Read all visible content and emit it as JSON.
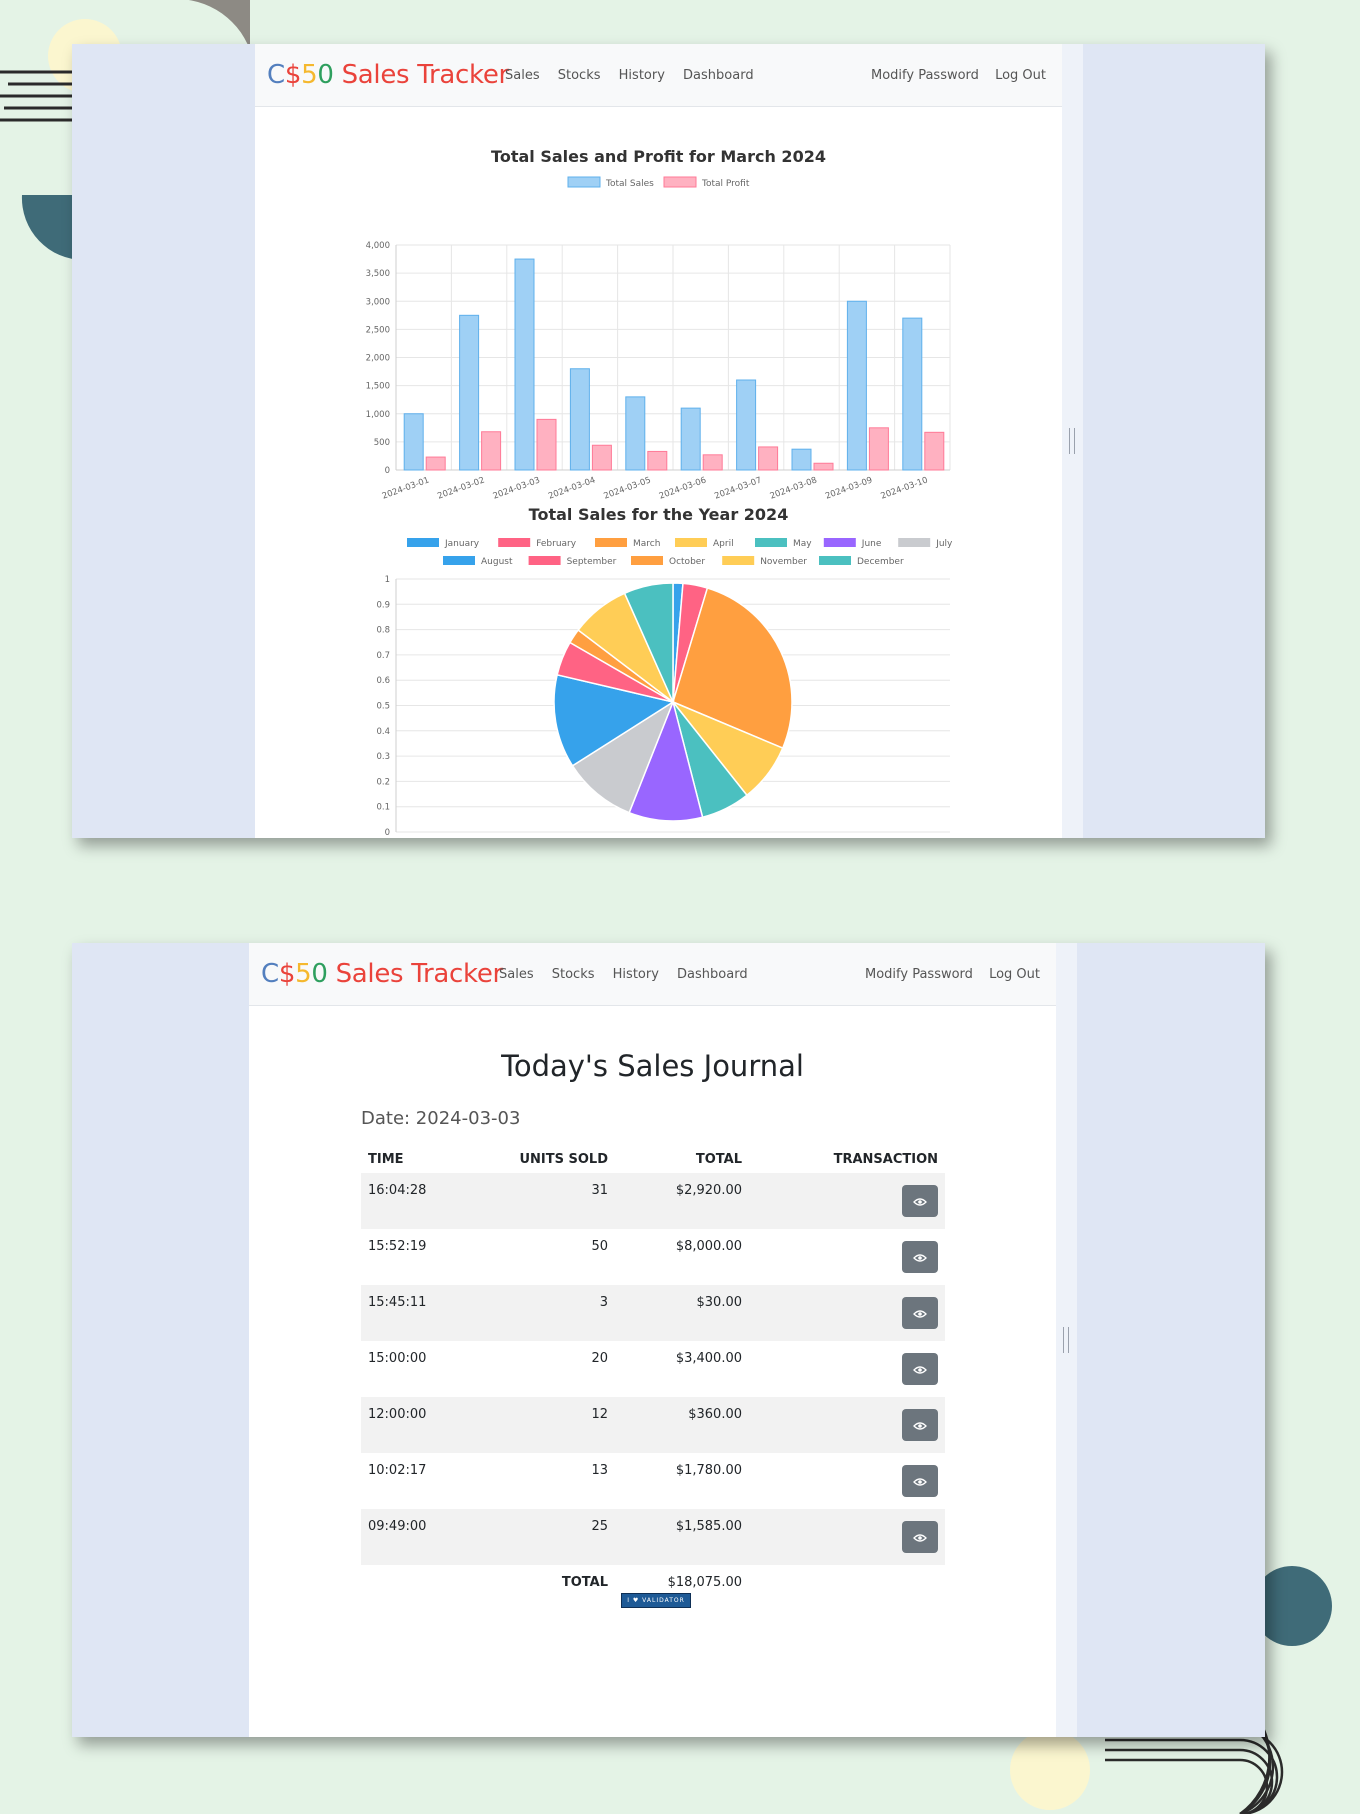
{
  "nav": {
    "brand_c": "C",
    "brand_dollar": "$",
    "brand_5": "5",
    "brand_0": "0",
    "brand_rest": " Sales Tracker",
    "links": [
      "Sales",
      "Stocks",
      "History",
      "Dashboard"
    ],
    "right_links": [
      "Modify Password",
      "Log Out"
    ]
  },
  "chart_data": [
    {
      "type": "bar",
      "title": "Total Sales and Profit for March 2024",
      "categories": [
        "2024-03-01",
        "2024-03-02",
        "2024-03-03",
        "2024-03-04",
        "2024-03-05",
        "2024-03-06",
        "2024-03-07",
        "2024-03-08",
        "2024-03-09",
        "2024-03-10"
      ],
      "series": [
        {
          "name": "Total Sales",
          "values": [
            1000,
            2750,
            3750,
            1800,
            1300,
            1100,
            1600,
            370,
            3000,
            2700
          ],
          "color": "#9fd0f5",
          "border": "#5fb0ec"
        },
        {
          "name": "Total Profit",
          "values": [
            230,
            680,
            900,
            440,
            330,
            270,
            410,
            120,
            750,
            670
          ],
          "color": "#ffb1c1",
          "border": "#ff7a97"
        }
      ],
      "ylim": [
        0,
        4000
      ],
      "yticks": [
        "0",
        "500",
        "1,000",
        "1,500",
        "2,000",
        "2,500",
        "3,000",
        "3,500",
        "4,000"
      ],
      "legend": "top",
      "grid": true
    },
    {
      "type": "pie",
      "title": "Total Sales for the Year 2024",
      "labels": [
        "January",
        "February",
        "March",
        "April",
        "May",
        "June",
        "July",
        "August",
        "September",
        "October",
        "November",
        "December"
      ],
      "values": [
        2,
        5,
        40,
        12,
        10,
        15,
        15,
        19,
        7,
        3,
        12,
        10
      ],
      "colors": [
        "#36a2eb",
        "#ff6384",
        "#ff9f40",
        "#ffcd56",
        "#4bc0c0",
        "#9966ff",
        "#c9cbcf",
        "#36a2eb",
        "#ff6384",
        "#ff9f40",
        "#ffcd56",
        "#4bc0c0"
      ],
      "yticks": [
        "0",
        "0.1",
        "0.2",
        "0.3",
        "0.4",
        "0.5",
        "0.6",
        "0.7",
        "0.8",
        "0.9",
        "1"
      ],
      "legend": "top",
      "grid": true
    }
  ],
  "journal": {
    "title": "Today's Sales Journal",
    "date": "Date: 2024-03-03",
    "headers": {
      "time": "TIME",
      "units": "UNITS SOLD",
      "total": "TOTAL",
      "transaction": "TRANSACTION"
    },
    "rows": [
      {
        "time": "16:04:28",
        "units": "31",
        "total": "$2,920.00"
      },
      {
        "time": "15:52:19",
        "units": "50",
        "total": "$8,000.00"
      },
      {
        "time": "15:45:11",
        "units": "3",
        "total": "$30.00"
      },
      {
        "time": "15:00:00",
        "units": "20",
        "total": "$3,400.00"
      },
      {
        "time": "12:00:00",
        "units": "12",
        "total": "$360.00"
      },
      {
        "time": "10:02:17",
        "units": "13",
        "total": "$1,780.00"
      },
      {
        "time": "09:49:00",
        "units": "25",
        "total": "$1,585.00"
      }
    ],
    "footer_label": "TOTAL",
    "footer_total": "$18,075.00",
    "view_icon": "eye-icon",
    "badge_text": "I ♥ VALIDATOR"
  }
}
